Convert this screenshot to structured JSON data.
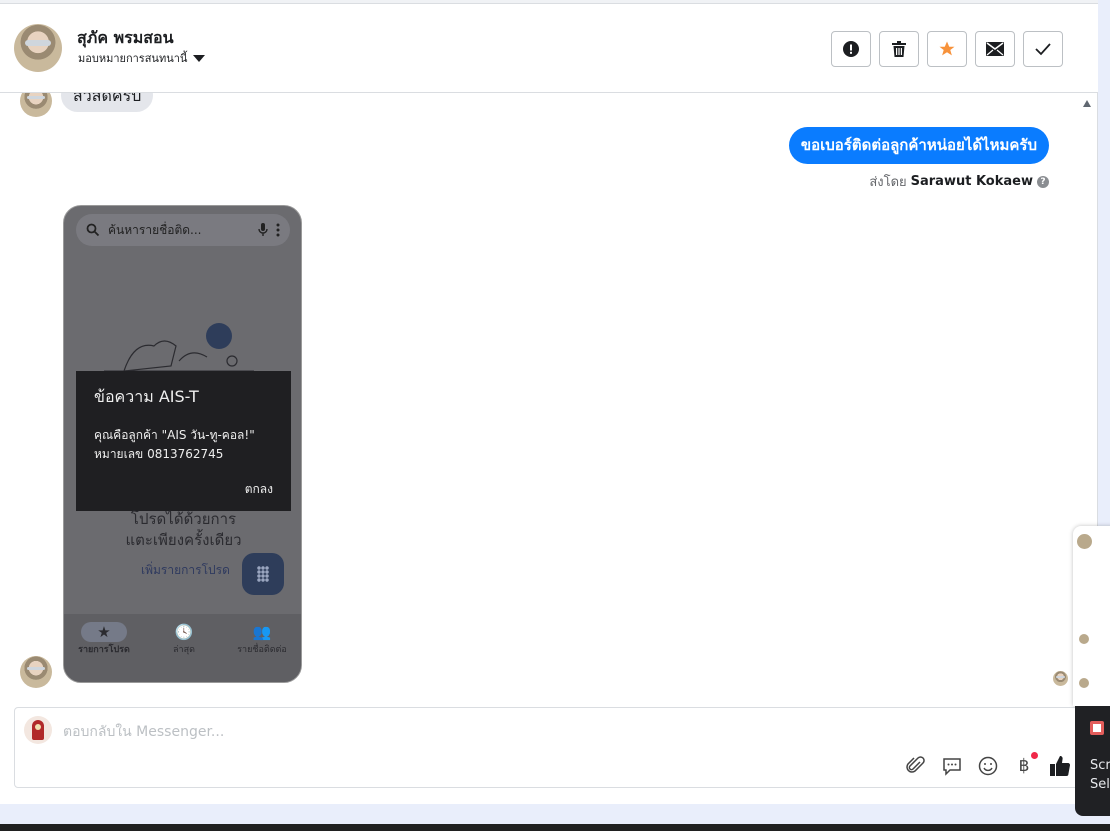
{
  "header": {
    "contact_name": "สุภัค พรมสอน",
    "assign_label": "มอบหมายการสนทนานี้",
    "actions": [
      "mark-spam",
      "delete",
      "star",
      "mark-unread",
      "mark-done"
    ]
  },
  "conversation": {
    "prev_incoming_text": "สวัสดีครับ",
    "outgoing_text": "ขอเบอร์ติดต่อลูกค้าหน่อยได้ไหมครับ",
    "sent_by_prefix": "ส่งโดย",
    "sent_by_name": "Sarawut Kokaew",
    "phone_screenshot": {
      "search_placeholder": "ค้นหารายชื่อติด...",
      "dialog_title": "ข้อความ AIS-T",
      "dialog_body_line1": "คุณคือลูกค้า \"AIS วัน-ทู-คอล!\"",
      "dialog_body_line2": "หมายเลข 0813762745",
      "dialog_ok": "ตกลง",
      "favorites_text_line1": "โปรดได้ด้วยการ",
      "favorites_text_line2": "แตะเพียงครั้งเดียว",
      "add_favorite": "เพิ่มรายการโปรด",
      "nav_tabs": [
        {
          "icon": "★",
          "label": "รายการโปรด"
        },
        {
          "icon": "🕓",
          "label": "ล่าสุด"
        },
        {
          "icon": "👥",
          "label": "รายชื่อติดต่อ"
        }
      ]
    }
  },
  "composer": {
    "placeholder": "ตอบกลับใน Messenger...",
    "pay_symbol": "฿"
  },
  "side_panel": {
    "dark_line1": "Scr",
    "dark_line2": "Sel"
  },
  "colors": {
    "accent_blue": "#0a7cff",
    "star_orange": "#f7923b",
    "notification_red": "#f02849"
  }
}
